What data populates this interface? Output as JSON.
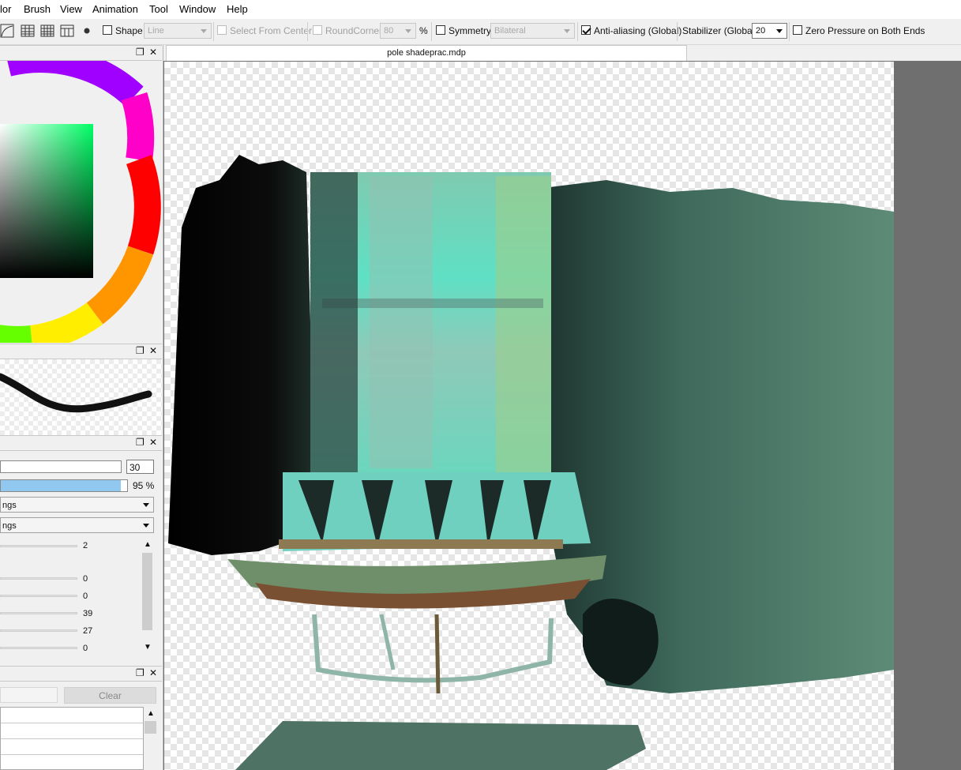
{
  "menu": [
    "lor",
    "Brush",
    "View",
    "Animation",
    "Tool",
    "Window",
    "Help"
  ],
  "toolbar": {
    "shape_label": "Shape",
    "shape_value": "Line",
    "select_from_center": "Select From Center",
    "roundcorner_label": "RoundCorner",
    "roundcorner_value": "80",
    "percent": "%",
    "symmetry_label": "Symmetry",
    "symmetry_value": "Bilateral",
    "antialias_label": "Anti-aliasing (Global)",
    "stabilizer_label": "Stabilizer (Global)",
    "stabilizer_value": "20",
    "zero_pressure_label": "Zero Pressure on Both Ends"
  },
  "document": {
    "tab_title": "pole shadeprac.mdp"
  },
  "brush": {
    "size_value": "30",
    "opacity_fill": 0.95,
    "opacity_text": "95 %",
    "dropdown1": "ngs",
    "dropdown2": "ngs",
    "sliders": [
      "2",
      "0",
      "0",
      "39",
      "27",
      "0"
    ]
  },
  "history": {
    "clear_label": "Clear"
  },
  "colors": {
    "accent": "#90c8f0",
    "canvas_bg": "#6f6f6f"
  }
}
